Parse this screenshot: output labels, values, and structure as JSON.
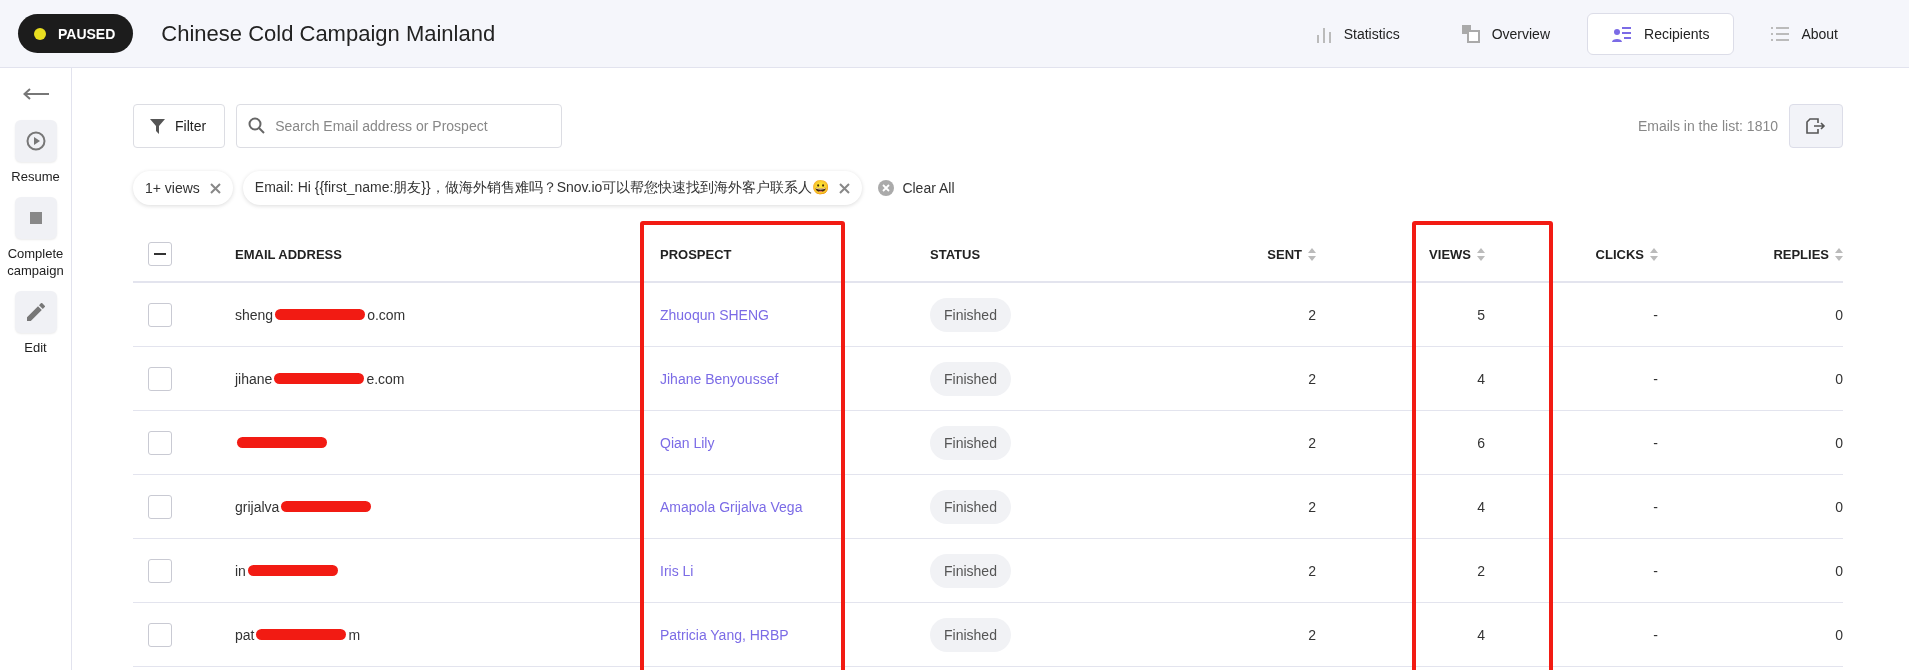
{
  "campaign": {
    "status": "PAUSED",
    "paused": true,
    "title": "Chinese Cold Campaign Mainland"
  },
  "nav": [
    {
      "label": "Statistics",
      "selected": false
    },
    {
      "label": "Overview",
      "selected": false
    },
    {
      "label": "Recipients",
      "selected": true
    },
    {
      "label": "About",
      "selected": false
    }
  ],
  "sidebar": [
    {
      "label": "Resume"
    },
    {
      "label": "Complete campaign"
    },
    {
      "label": "Edit"
    }
  ],
  "toolbar": {
    "filter": "Filter",
    "search_placeholder": "Search Email address or Prospect",
    "count": "Emails in the list: 1810"
  },
  "filters": [
    {
      "label": "1+ views"
    },
    {
      "label": "Email: Hi {{first_name:朋友}}，做海外销售难吗？Snov.io可以帮您快速找到海外客户联系人😀"
    }
  ],
  "clear_all": "Clear All",
  "table": {
    "select_all_partial": true,
    "columns": [
      {
        "label": "EMAIL ADDRESS",
        "sortable": false,
        "highlighted": false
      },
      {
        "label": "PROSPECT",
        "sortable": false,
        "highlighted": true
      },
      {
        "label": "STATUS",
        "sortable": false,
        "highlighted": false
      },
      {
        "label": "SENT",
        "sortable": true,
        "highlighted": false
      },
      {
        "label": "VIEWS",
        "sortable": true,
        "highlighted": true
      },
      {
        "label": "CLICKS",
        "sortable": true,
        "highlighted": false
      },
      {
        "label": "REPLIES",
        "sortable": true,
        "highlighted": false
      }
    ],
    "rows": [
      {
        "checked": false,
        "email_start": "sheng",
        "email_end": "o.com",
        "prospect": "Zhuoqun SHENG",
        "status": "Finished",
        "sent": "2",
        "views": "5",
        "clicks": "-",
        "replies": "0"
      },
      {
        "checked": false,
        "email_start": "jihane",
        "email_end": "e.com",
        "prospect": "Jihane Benyoussef",
        "status": "Finished",
        "sent": "2",
        "views": "4",
        "clicks": "-",
        "replies": "0"
      },
      {
        "checked": false,
        "prospect": "Qian Lily",
        "status": "Finished",
        "sent": "2",
        "views": "6",
        "clicks": "-",
        "replies": "0"
      },
      {
        "checked": false,
        "email_start": "grijalva",
        "prospect": "Amapola Grijalva Vega",
        "status": "Finished",
        "sent": "2",
        "views": "4",
        "clicks": "-",
        "replies": "0"
      },
      {
        "checked": false,
        "email_start": "in",
        "prospect": "Iris Li",
        "status": "Finished",
        "sent": "2",
        "views": "2",
        "clicks": "-",
        "replies": "0"
      },
      {
        "checked": false,
        "email_start": "pat",
        "email_end": "m",
        "prospect": "Patricia Yang, HRBP",
        "status": "Finished",
        "sent": "2",
        "views": "4",
        "clicks": "-",
        "replies": "0"
      }
    ]
  }
}
